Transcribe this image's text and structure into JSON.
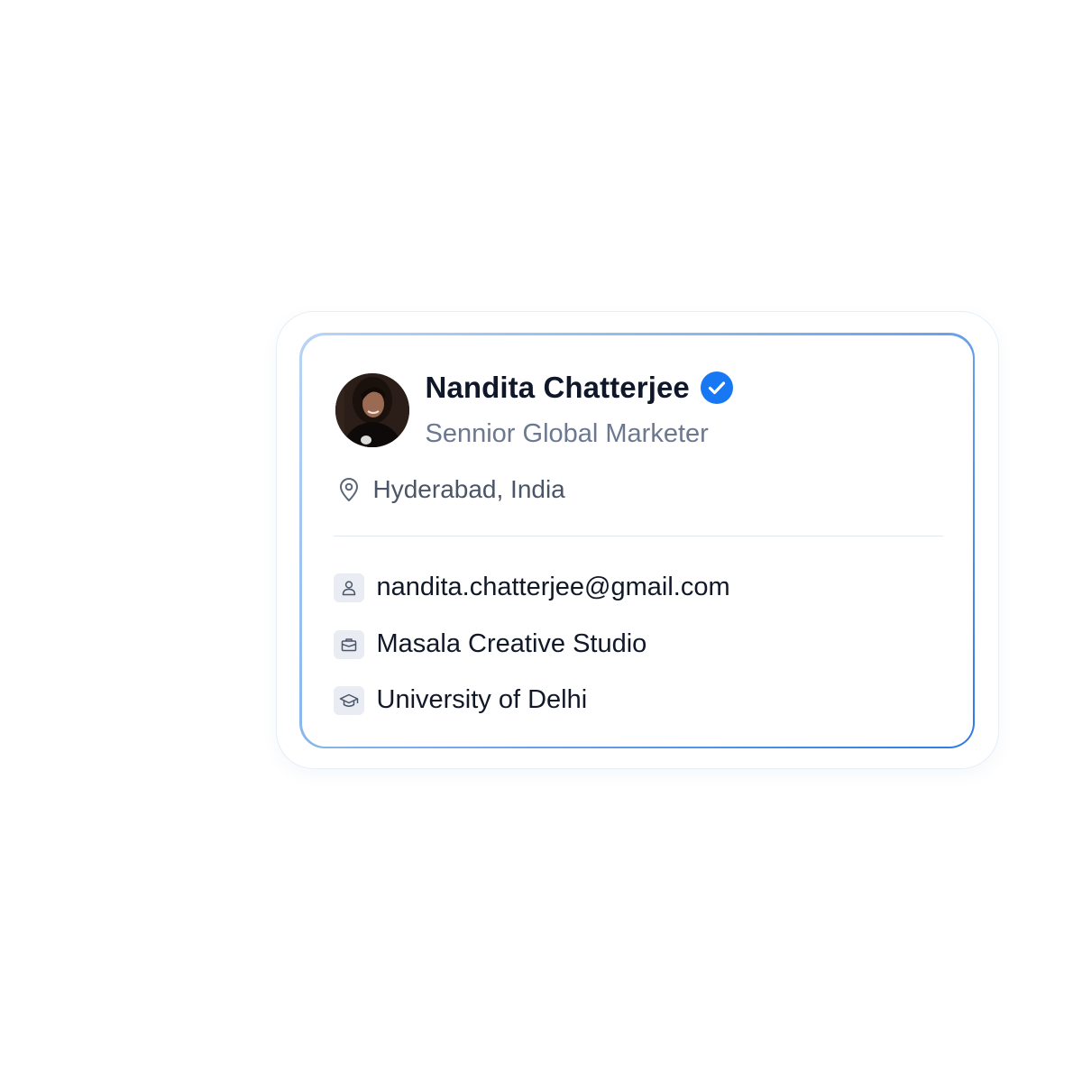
{
  "profile": {
    "name": "Nandita Chatterjee",
    "role": "Sennior Global Marketer",
    "location": "Hyderabad, India",
    "verified": true,
    "avatar_icon": "profile-photo"
  },
  "details": {
    "email": "nandita.chatterjee@gmail.com",
    "company": "Masala Creative Studio",
    "education": "University of Delhi"
  },
  "icons": {
    "verified": "verified-check-icon",
    "location": "map-pin-icon",
    "email": "user-icon",
    "company": "briefcase-icon",
    "education": "graduation-cap-icon"
  },
  "colors": {
    "accent": "#1877f2",
    "name": "#0f1729",
    "muted": "#6b7890",
    "border_gradient_start": "#b9d4f4",
    "border_gradient_end": "#2e7be6"
  }
}
